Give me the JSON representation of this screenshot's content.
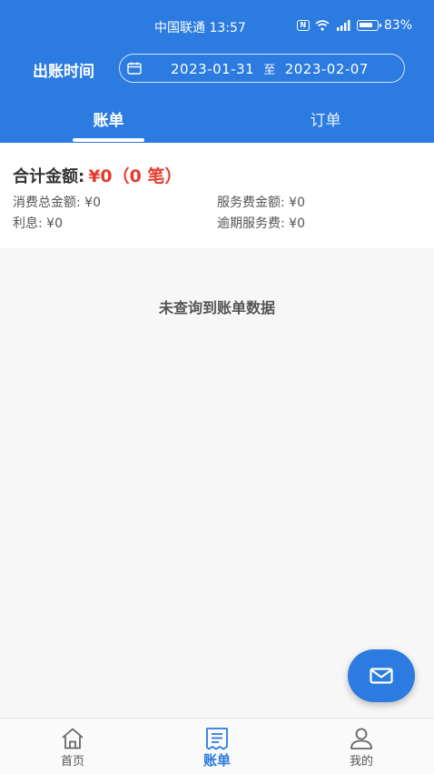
{
  "status_bar": {
    "carrier_time": "中国联通 13:57",
    "battery": "83%"
  },
  "filter": {
    "label": "出账时间",
    "start_date": "2023-01-31",
    "separator": "至",
    "end_date": "2023-02-07"
  },
  "tabs": [
    {
      "label": "账单",
      "active": true
    },
    {
      "label": "订单",
      "active": false
    }
  ],
  "summary": {
    "total_label": "合计金额:",
    "total_value": "¥0（0 笔）",
    "consume_label": "消费总金额:",
    "consume_value": "¥0",
    "service_label": "服务费金额:",
    "service_value": "¥0",
    "interest_label": "利息:",
    "interest_value": "¥0",
    "overdue_label": "逾期服务费:",
    "overdue_value": "¥0"
  },
  "empty_message": "未查询到账单数据",
  "fab": {
    "icon": "mail-icon"
  },
  "bottom_nav": [
    {
      "label": "首页",
      "icon": "home-icon",
      "active": false
    },
    {
      "label": "账单",
      "icon": "bill-icon",
      "active": true
    },
    {
      "label": "我的",
      "icon": "user-icon",
      "active": false
    }
  ],
  "colors": {
    "primary": "#2b7be0",
    "accent_red": "#e53b2c"
  }
}
